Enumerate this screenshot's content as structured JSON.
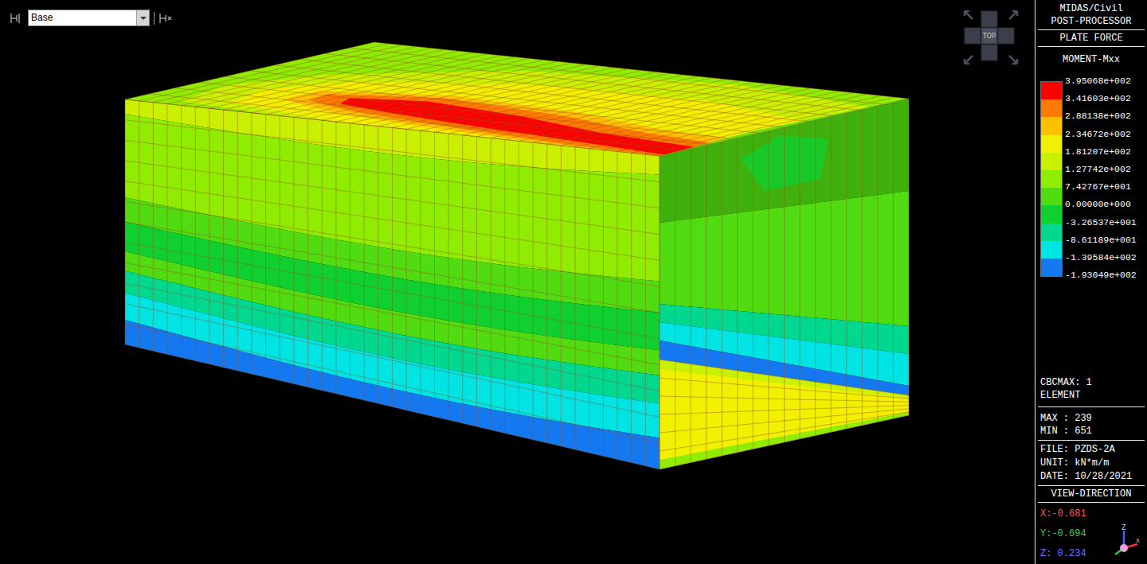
{
  "toolbar": {
    "dropdown": {
      "value": "Base"
    }
  },
  "view_cube": {
    "label": "TOP"
  },
  "panel": {
    "program": "MIDAS/Civil",
    "mode": "POST-PROCESSOR",
    "result_type": "PLATE FORCE",
    "component": "MOMENT-Mxx",
    "legend": {
      "values": [
        "3.95068e+002",
        "3.41603e+002",
        "2.88138e+002",
        "2.34672e+002",
        "1.81207e+002",
        "1.27742e+002",
        "7.42767e+001",
        "0.00000e+000",
        "-3.26537e+001",
        "-8.61189e+001",
        "-1.39584e+002",
        "-1.93049e+002"
      ],
      "bands": [
        {
          "color": "#ff0000"
        },
        {
          "color": "#ff7a00"
        },
        {
          "color": "#ffc000"
        },
        {
          "color": "#f0f000"
        },
        {
          "color": "#c8f000"
        },
        {
          "color": "#90ec00"
        },
        {
          "color": "#50dc10"
        },
        {
          "color": "#10d030"
        },
        {
          "color": "#00d890"
        },
        {
          "color": "#00e4e4"
        },
        {
          "color": "#1478f0"
        }
      ]
    },
    "info": [
      "CBCMAX: 1",
      "ELEMENT"
    ],
    "extremes": [
      "MAX : 239",
      "MIN : 651"
    ],
    "file_info": [
      "FILE: PZDS-2A",
      "UNIT: kN*m/m",
      "DATE: 10/28/2021"
    ],
    "view_direction": {
      "title": "VIEW-DIRECTION",
      "axes": [
        {
          "text": "X:-0.681",
          "color": "#ff5050"
        },
        {
          "text": "Y:-0.694",
          "color": "#40d040"
        },
        {
          "text": "Z: 0.234",
          "color": "#7070ff"
        }
      ]
    },
    "triad": {
      "labels": [
        "Z",
        "X"
      ]
    }
  }
}
